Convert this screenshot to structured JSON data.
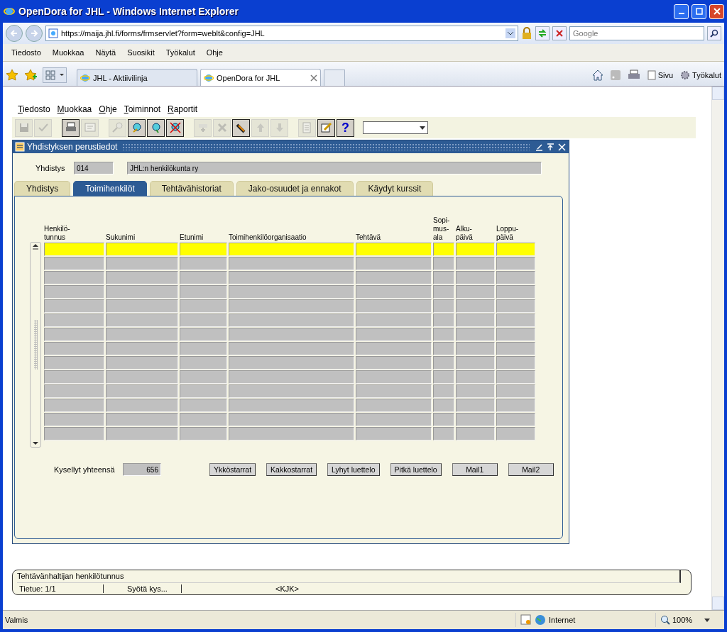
{
  "browser": {
    "title": "OpenDora for JHL - Windows Internet Explorer",
    "address": "https://maija.jhl.fi/forms/frmservlet?form=weblt&config=JHL",
    "search": {
      "placeholder": "Google"
    },
    "menu": [
      "Tiedosto",
      "Muokkaa",
      "Näytä",
      "Suosikit",
      "Työkalut",
      "Ohje"
    ],
    "tabs": [
      {
        "label": "JHL - Aktiivilinja",
        "selected": false
      },
      {
        "label": "OpenDora for JHL",
        "selected": true
      }
    ],
    "command_bar": [
      "Sivu",
      "Työkalut"
    ],
    "status_bar": {
      "text": "Valmis",
      "zone": "Internet",
      "zoom": "100%"
    }
  },
  "app": {
    "menu": [
      "Tiedosto",
      "Muokkaa",
      "Ohje",
      "Toiminnot",
      "Raportit"
    ],
    "toolbar": [
      {
        "kind": "save",
        "disabled": true
      },
      {
        "kind": "check",
        "disabled": true
      },
      {
        "kind": "print",
        "disabled": false
      },
      {
        "kind": "preview",
        "disabled": true
      },
      {
        "kind": "search",
        "disabled": true
      },
      {
        "kind": "query-enter",
        "disabled": false
      },
      {
        "kind": "query-run",
        "disabled": false
      },
      {
        "kind": "query-cancel",
        "disabled": false
      },
      {
        "kind": "insert",
        "disabled": true
      },
      {
        "kind": "delete",
        "disabled": true
      },
      {
        "kind": "clear",
        "disabled": false
      },
      {
        "kind": "up",
        "disabled": true
      },
      {
        "kind": "down",
        "disabled": true
      },
      {
        "kind": "list",
        "disabled": true
      },
      {
        "kind": "edit",
        "disabled": false
      },
      {
        "kind": "help",
        "disabled": false,
        "label": "?"
      }
    ],
    "window": {
      "title": "Yhdistyksen perustiedot",
      "field": {
        "label": "Yhdistys",
        "code": "014",
        "name": "JHL:n henkilökunta ry"
      },
      "tabs": [
        {
          "label": "Yhdistys",
          "selected": false
        },
        {
          "label": "Toimihenkilöt",
          "selected": true
        },
        {
          "label": "Tehtävähistoriat",
          "selected": false
        },
        {
          "label": "Jako-osuudet ja ennakot",
          "selected": false
        },
        {
          "label": "Käydyt kurssit",
          "selected": false
        }
      ],
      "table": {
        "columns": [
          [
            "Henkilö-",
            "tunnus"
          ],
          [
            "Sukunimi"
          ],
          [
            "Etunimi"
          ],
          [
            "Toimihenkilöorganisaatio"
          ],
          [
            "Tehtävä"
          ],
          [
            "Sopi-",
            "mus-",
            "ala"
          ],
          [
            "Alku-",
            "päivä"
          ],
          [
            "Loppu-",
            "päivä"
          ]
        ],
        "rows": [
          {
            "selected": true
          },
          {
            "selected": false
          },
          {
            "selected": false
          },
          {
            "selected": false
          },
          {
            "selected": false
          },
          {
            "selected": false
          },
          {
            "selected": false
          },
          {
            "selected": false
          },
          {
            "selected": false
          },
          {
            "selected": false
          },
          {
            "selected": false
          },
          {
            "selected": false
          },
          {
            "selected": false
          },
          {
            "selected": false
          }
        ]
      },
      "count": {
        "label": "Kysellyt yhteensä",
        "value": "656"
      },
      "buttons": [
        "Ykköstarrat",
        "Kakkostarrat",
        "Lyhyt luettelo",
        "Pitkä luettelo",
        "Mail1",
        "Mail2"
      ]
    },
    "hint": "Tehtävänhaltijan henkilötunnus",
    "status": [
      "Tietue: 1/1",
      "Syötä kys...",
      "<KJK>"
    ]
  }
}
